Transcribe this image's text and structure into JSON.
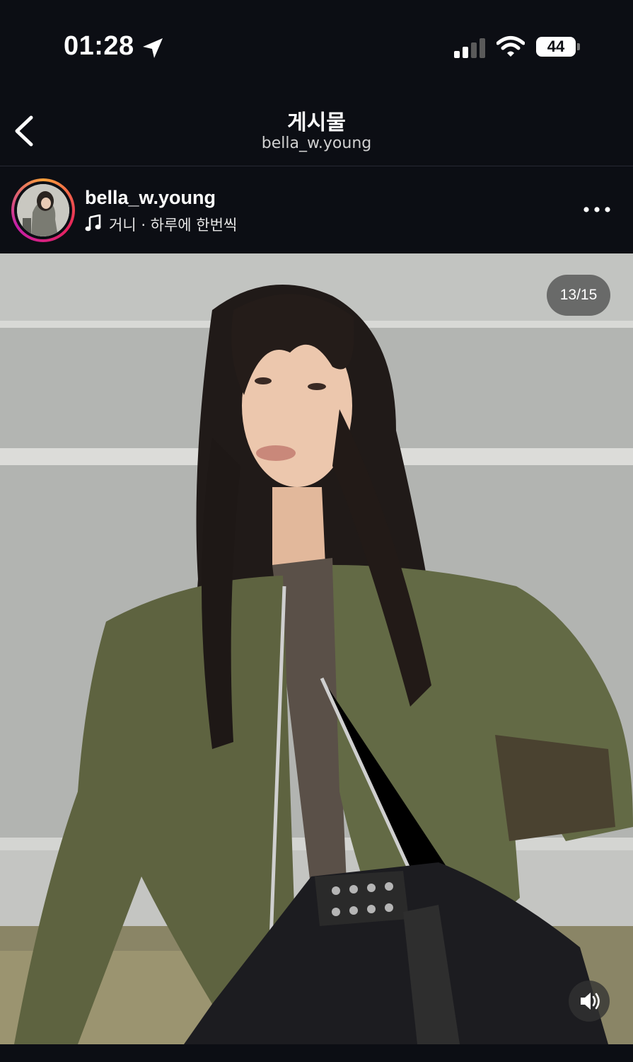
{
  "status_bar": {
    "time": "01:28",
    "battery": "44"
  },
  "header": {
    "title": "게시물",
    "subtitle": "bella_w.young"
  },
  "post": {
    "username": "bella_w.young",
    "music": "거니 · 하루에 한번씩",
    "counter": "13/15"
  },
  "colors": {
    "background": "#0c0e14",
    "story_ring": [
      "#f9a13a",
      "#e8245b",
      "#c41fa7"
    ]
  },
  "icons": [
    "location-arrow-icon",
    "signal-icon",
    "wifi-icon",
    "battery-icon",
    "back-chevron-icon",
    "music-note-icon",
    "more-dots-icon",
    "speaker-icon"
  ]
}
